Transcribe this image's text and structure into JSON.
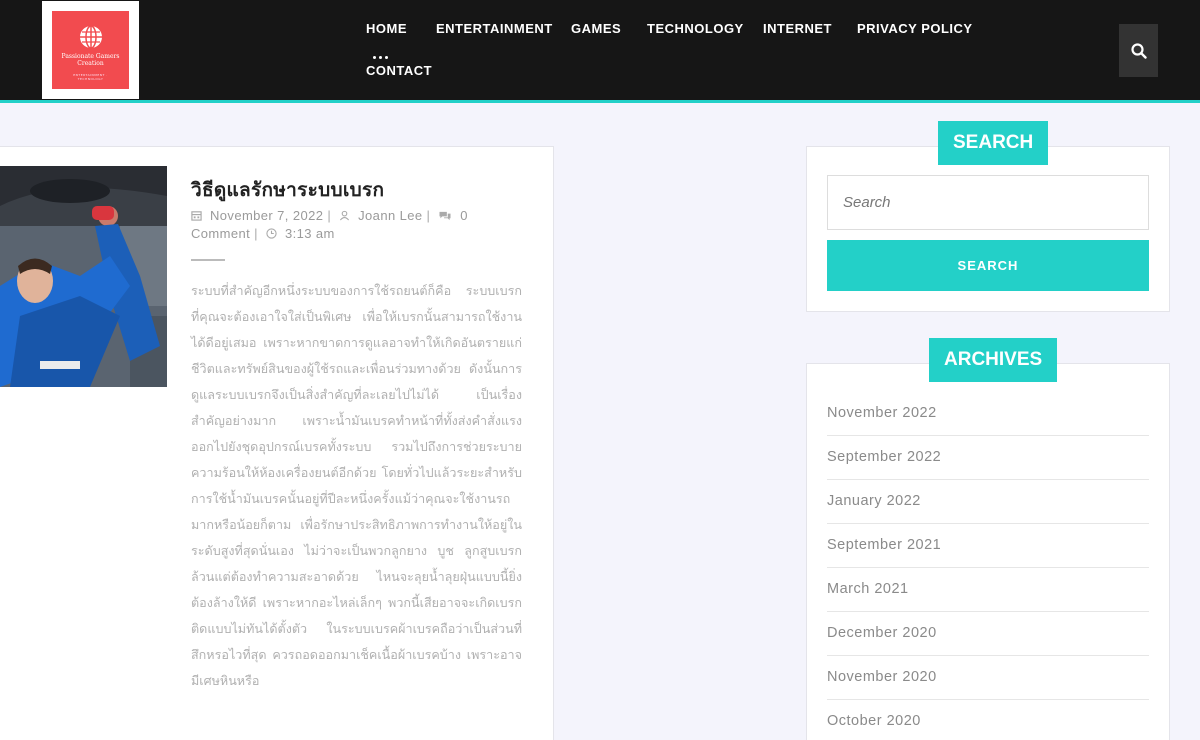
{
  "logo": {
    "text": "Passionate Gamers Creation",
    "subtext": "ENTERTAINMENT · TECHNOLOGY"
  },
  "nav": {
    "items": [
      {
        "label": "HOME"
      },
      {
        "label": "ENTERTAINMENT"
      },
      {
        "label": "GAMES"
      },
      {
        "label": "TECHNOLOGY"
      },
      {
        "label": "INTERNET"
      },
      {
        "label": "PRIVACY POLICY"
      },
      {
        "label": "CONTACT"
      }
    ],
    "active": "HOME",
    "search_icon": "search-icon"
  },
  "post": {
    "title": "วิธีดูแลรักษาระบบเบรก",
    "date": "November 7, 2022",
    "author": "Joann Lee",
    "comments": "0 Comment",
    "time": "3:13 am",
    "excerpt": "ระบบที่สำคัญอีกหนึ่งระบบของการใช้รถยนต์ก็คือ ระบบเบรก ที่คุณจะต้องเอาใจใส่เป็นพิเศษ เพื่อให้เบรกนั้นสามารถใช้งานได้ดีอยู่เสมอ เพราะหากขาดการดูแลอาจทำให้เกิดอันตรายแก่ชีวิตและทรัพย์สินของผู้ใช้รถและเพื่อนร่วมทางด้วย ดังนั้นการดูแลระบบเบรกจึงเป็นสิ่งสำคัญที่ละเลยไปไม่ได้ เป็นเรื่องสำคัญอย่างมาก เพราะน้ำมันเบรคทำหน้าที่ทั้งส่งคำสั่งแรงออกไปยังชุดอุปกรณ์เบรคทั้งระบบ รวมไปถึงการช่วยระบายความร้อนให้ห้องเครื่องยนต์อีกด้วย โดยทั่วไปแล้วระยะสำหรับการใช้น้ำมันเบรคนั้นอยู่ที่ปีละหนึ่งครั้งแม้ว่าคุณจะใช้งานรถมากหรือน้อยก็ตาม เพื่อรักษาประสิทธิภาพการทำงานให้อยู่ในระดับสูงที่สุดนั่นเอง ไม่ว่าจะเป็นพวกลูกยาง บูช ลูกสูบเบรก ล้วนแต่ต้องทำความสะอาดด้วย ไหนจะลุยน้ำลุยฝุ่นแบบนี้ยิ่งต้องล้างให้ดี เพราะหากอะไหล่เล็กๆ พวกนี้เสียอาจจะเกิดเบรกติดแบบไม่ทันได้ตั้งตัว ในระบบเบรคผ้าเบรคถือว่าเป็นส่วนที่สึกหรอไวที่สุด ควรถอดออกมาเช็คเนื้อผ้าเบรคบ้าง เพราะอาจมีเศษหินหรือ"
  },
  "sidebar": {
    "search": {
      "title": "SEARCH",
      "placeholder": "Search",
      "button_label": "SEARCH"
    },
    "archives": {
      "title": "ARCHIVES",
      "items": [
        "November 2022",
        "September 2022",
        "January 2022",
        "September 2021",
        "March 2021",
        "December 2020",
        "November 2020",
        "October 2020"
      ]
    }
  },
  "colors": {
    "accent": "#23d0c8",
    "header_bg": "#161616",
    "page_bg": "#f4f4fc",
    "logo_bg": "#f24b4f"
  }
}
